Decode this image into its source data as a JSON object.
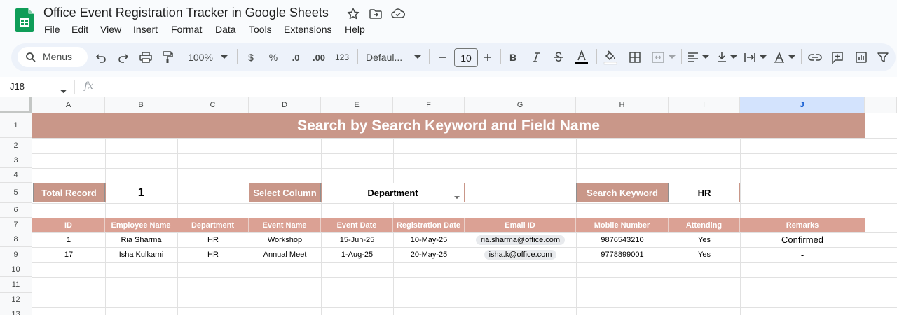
{
  "app": {
    "title": "Office Event Registration Tracker in Google Sheets",
    "menu": [
      "File",
      "Edit",
      "View",
      "Insert",
      "Format",
      "Data",
      "Tools",
      "Extensions",
      "Help"
    ]
  },
  "toolbar": {
    "search_label": "Menus",
    "zoom": "100%",
    "currency": "$",
    "percent": "%",
    "decrease_decimal": ".0",
    "increase_decimal": ".00",
    "number_format": "123",
    "font_family": "Defaul...",
    "font_size": "10"
  },
  "formula_bar": {
    "cell_ref": "J18",
    "fx": "fx",
    "value": ""
  },
  "grid": {
    "columns": [
      "A",
      "B",
      "C",
      "D",
      "E",
      "F",
      "G",
      "H",
      "I",
      "J"
    ],
    "selected_column": "J",
    "rows": [
      "1",
      "2",
      "3",
      "4",
      "5",
      "6",
      "7",
      "8",
      "9",
      "10",
      "11",
      "12",
      "13"
    ]
  },
  "sheet": {
    "banner": "Search by Search Keyword and Field Name",
    "total_record_label": "Total Record",
    "total_record_value": "1",
    "select_column_label": "Select Column",
    "select_column_value": "Department",
    "search_keyword_label": "Search Keyword",
    "search_keyword_value": "HR",
    "table": {
      "headers": [
        "ID",
        "Employee Name",
        "Department",
        "Event Name",
        "Event Date",
        "Registration Date",
        "Email ID",
        "Mobile Number",
        "Attending",
        "Remarks"
      ],
      "rows": [
        [
          "1",
          "Ria Sharma",
          "HR",
          "Workshop",
          "15-Jun-25",
          "10-May-25",
          "ria.sharma@office.com",
          "9876543210",
          "Yes",
          "Confirmed"
        ],
        [
          "17",
          "Isha Kulkarni",
          "HR",
          "Annual Meet",
          "1-Aug-25",
          "20-May-25",
          "isha.k@office.com",
          "9778899001",
          "Yes",
          "-"
        ]
      ]
    }
  },
  "colors": {
    "banner": "#c99789",
    "table_header": "#dba194",
    "selected_column_header": "#d3e3fd",
    "sheets_green": "#0f9d58"
  }
}
